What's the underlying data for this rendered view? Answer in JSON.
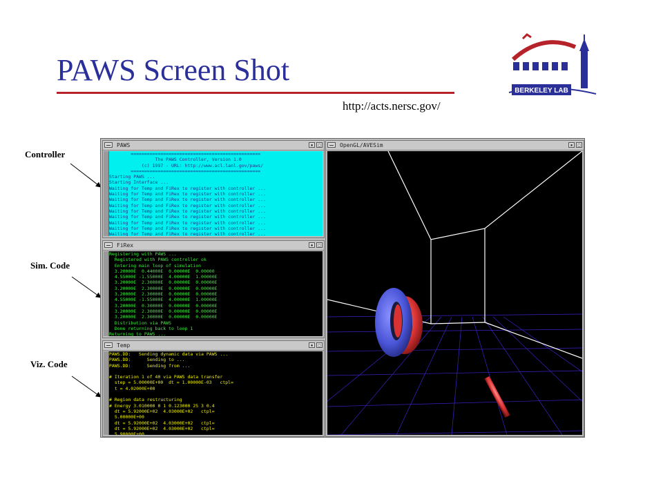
{
  "slide": {
    "title": "PAWS Screen Shot",
    "url": "http://acts.nersc.gov/",
    "logo_text": "BERKELEY LAB",
    "labels": {
      "controller": "Controller",
      "sim": "Sim. Code",
      "viz": "Viz. Code"
    }
  },
  "colors": {
    "title": "#2b2f9a",
    "rule": "#b5222a",
    "controller_bg": "#00f0f0",
    "sim_text": "#3bf03b",
    "viz_text": "#f0f000",
    "torus_blue": "#4a55d8",
    "torus_red": "#d83232",
    "grid": "#3a22c8"
  },
  "windows": {
    "controller": {
      "title": "PAWS",
      "lines": [
        "        ================================================",
        "                 The PAWS Controller, Version 1.0",
        "            (c) 1997 - URL: http://www.acl.lanl.gov/paws/",
        "        ================================================",
        "Starting PAWS ...",
        "Starting Interface ...",
        "Waiting for Temp and FiRex to register with controller ...",
        "Waiting for Temp and FiRex to register with controller ...",
        "Waiting for Temp and FiRex to register with controller ...",
        "Waiting for Temp and FiRex to register with controller ...",
        "Waiting for Temp and FiRex to register with controller ...",
        "Waiting for Temp and FiRex to register with controller ...",
        "Waiting for Temp and FiRex to register with controller ...",
        "Waiting for Temp and FiRex to register with controller ...",
        "Waiting for Temp and FiRex to register with controller ..."
      ]
    },
    "sim": {
      "title": "FiRex",
      "lines": [
        "Registering with PAWS ...",
        "  Registered with PAWS controller ok",
        "  Entering main loop of simulation",
        "  3.20000E  0.44000E  0.00000E  0.00000",
        "  4.55000E -1.55000E  4.00000E  1.00000E",
        "  3.20000E  2.30000E  0.00000E  0.00000E",
        "  3.20000E  2.30000E  0.00000E  0.00000E",
        "  3.20000E  2.30000E  0.00000E  0.00000E",
        "  4.55000E -1.55000E  4.00000E  1.00000E",
        "  3.20000E  0.30000E  0.00000E  0.00000E",
        "  3.20000E  2.30000E  0.00000E  0.00000E",
        "  3.20000E  2.30000E  0.00000E  0.00000E",
        "  Distribution via PAWS",
        "  Done returning back to loop 1",
        "Returning to PAWS ...",
        "[]"
      ]
    },
    "viz": {
      "title": "Temp",
      "lines": [
        "PAWS.DD:   Sending dynamic data via PAWS ...",
        "PAWS.DD:      Sending to ...",
        "PAWS.DD:      Sending from ...",
        "",
        "# Iteration 1 of 40 via PAWS data transfer",
        "  step = 5.00000E+00  dt = 1.00000E-03   ctpl=",
        "  t = 4.02000E+00",
        "",
        "# Region data restructuring",
        "# Energy 3.010000 0 1 0.123000 25 3 0.4",
        "  dt = 5.92000E+02  4.03000E+02   ctpl=",
        "  5.00000E+00",
        "  dt = 5.92000E+02  4.03000E+02   ctpl=",
        "  dt = 5.92000E+02  4.03000E+02   ctpl=",
        "  5.90000E+00",
        "  dt = 5.92000E+02  4.03000E+02   ctpl="
      ]
    },
    "viewer": {
      "title": "OpenGL/AVESim"
    }
  }
}
